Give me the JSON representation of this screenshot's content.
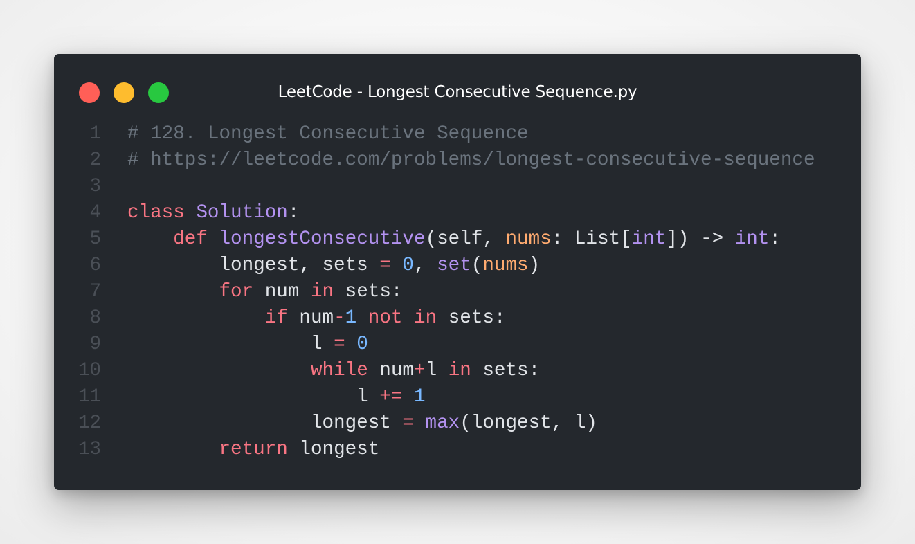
{
  "window": {
    "title": "LeetCode - Longest Consecutive Sequence.py",
    "buttons": {
      "close": "close-button",
      "minimize": "minimize-button",
      "maximize": "maximize-button"
    }
  },
  "colors": {
    "background": "#24282d",
    "comment": "#6a737d",
    "keyword": "#f97583",
    "class_name": "#b392f0",
    "function": "#b392f0",
    "parameter": "#ffab70",
    "number": "#79b8ff",
    "text": "#e1e4e8",
    "line_number": "#4a4f56",
    "close": "#ff5f57",
    "minimize": "#febc2e",
    "maximize": "#28c840"
  },
  "code": {
    "language": "python",
    "lines": [
      {
        "n": "1",
        "tokens": [
          {
            "t": "# 128. Longest Consecutive Sequence",
            "c": "comment"
          }
        ]
      },
      {
        "n": "2",
        "tokens": [
          {
            "t": "# https://leetcode.com/problems/longest-consecutive-sequence",
            "c": "comment"
          }
        ]
      },
      {
        "n": "3",
        "tokens": []
      },
      {
        "n": "4",
        "tokens": [
          {
            "t": "class",
            "c": "kw"
          },
          {
            "t": " ",
            "c": "plain"
          },
          {
            "t": "Solution",
            "c": "cls"
          },
          {
            "t": ":",
            "c": "plain"
          }
        ]
      },
      {
        "n": "5",
        "tokens": [
          {
            "t": "    ",
            "c": "plain"
          },
          {
            "t": "def",
            "c": "kw"
          },
          {
            "t": " ",
            "c": "plain"
          },
          {
            "t": "longestConsecutive",
            "c": "fn"
          },
          {
            "t": "(self, ",
            "c": "plain"
          },
          {
            "t": "nums",
            "c": "param"
          },
          {
            "t": ": List[",
            "c": "plain"
          },
          {
            "t": "int",
            "c": "builtin"
          },
          {
            "t": "]) -> ",
            "c": "plain"
          },
          {
            "t": "int",
            "c": "builtin"
          },
          {
            "t": ":",
            "c": "plain"
          }
        ]
      },
      {
        "n": "6",
        "tokens": [
          {
            "t": "        longest, sets ",
            "c": "plain"
          },
          {
            "t": "=",
            "c": "op"
          },
          {
            "t": " ",
            "c": "plain"
          },
          {
            "t": "0",
            "c": "num"
          },
          {
            "t": ", ",
            "c": "plain"
          },
          {
            "t": "set",
            "c": "builtin"
          },
          {
            "t": "(",
            "c": "plain"
          },
          {
            "t": "nums",
            "c": "param"
          },
          {
            "t": ")",
            "c": "plain"
          }
        ]
      },
      {
        "n": "7",
        "tokens": [
          {
            "t": "        ",
            "c": "plain"
          },
          {
            "t": "for",
            "c": "kw"
          },
          {
            "t": " num ",
            "c": "plain"
          },
          {
            "t": "in",
            "c": "kw"
          },
          {
            "t": " sets:",
            "c": "plain"
          }
        ]
      },
      {
        "n": "8",
        "tokens": [
          {
            "t": "            ",
            "c": "plain"
          },
          {
            "t": "if",
            "c": "kw"
          },
          {
            "t": " num",
            "c": "plain"
          },
          {
            "t": "-",
            "c": "op"
          },
          {
            "t": "1",
            "c": "num"
          },
          {
            "t": " ",
            "c": "plain"
          },
          {
            "t": "not",
            "c": "kw"
          },
          {
            "t": " ",
            "c": "plain"
          },
          {
            "t": "in",
            "c": "kw"
          },
          {
            "t": " sets:",
            "c": "plain"
          }
        ]
      },
      {
        "n": "9",
        "tokens": [
          {
            "t": "                l ",
            "c": "plain"
          },
          {
            "t": "=",
            "c": "op"
          },
          {
            "t": " ",
            "c": "plain"
          },
          {
            "t": "0",
            "c": "num"
          }
        ]
      },
      {
        "n": "10",
        "tokens": [
          {
            "t": "                ",
            "c": "plain"
          },
          {
            "t": "while",
            "c": "kw"
          },
          {
            "t": " num",
            "c": "plain"
          },
          {
            "t": "+",
            "c": "op"
          },
          {
            "t": "l ",
            "c": "plain"
          },
          {
            "t": "in",
            "c": "kw"
          },
          {
            "t": " sets:",
            "c": "plain"
          }
        ]
      },
      {
        "n": "11",
        "tokens": [
          {
            "t": "                    l ",
            "c": "plain"
          },
          {
            "t": "+=",
            "c": "op"
          },
          {
            "t": " ",
            "c": "plain"
          },
          {
            "t": "1",
            "c": "num"
          }
        ]
      },
      {
        "n": "12",
        "tokens": [
          {
            "t": "                longest ",
            "c": "plain"
          },
          {
            "t": "=",
            "c": "op"
          },
          {
            "t": " ",
            "c": "plain"
          },
          {
            "t": "max",
            "c": "builtin"
          },
          {
            "t": "(longest, l)",
            "c": "plain"
          }
        ]
      },
      {
        "n": "13",
        "tokens": [
          {
            "t": "        ",
            "c": "plain"
          },
          {
            "t": "return",
            "c": "kw"
          },
          {
            "t": " longest",
            "c": "plain"
          }
        ]
      }
    ]
  }
}
